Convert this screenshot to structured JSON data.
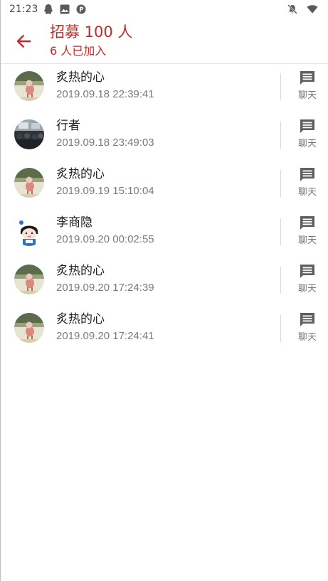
{
  "status_bar": {
    "time": "21:23",
    "icons_left": [
      "qq-icon",
      "image-icon",
      "p-icon"
    ],
    "icons_right": [
      "bell-off-icon",
      "wifi-icon"
    ]
  },
  "app_bar": {
    "title": "招募 100 人",
    "subtitle": "6 人已加入",
    "accent_color": "#c62828"
  },
  "members": [
    {
      "name": "炙热的心",
      "time": "2019.09.18 22:39:41",
      "avatar": "sheep-avatar",
      "chat_label": "聊天"
    },
    {
      "name": "行者",
      "time": "2019.09.18 23:49:03",
      "avatar": "crowd-photo-avatar",
      "chat_label": "聊天"
    },
    {
      "name": "炙热的心",
      "time": "2019.09.19 15:10:04",
      "avatar": "sheep-avatar",
      "chat_label": "聊天"
    },
    {
      "name": "李商隐",
      "time": "2019.09.20 00:02:55",
      "avatar": "cartoon-girl-avatar",
      "chat_label": "聊天"
    },
    {
      "name": "炙热的心",
      "time": "2019.09.20 17:24:39",
      "avatar": "sheep-avatar",
      "chat_label": "聊天"
    },
    {
      "name": "炙热的心",
      "time": "2019.09.20 17:24:41",
      "avatar": "sheep-avatar",
      "chat_label": "聊天"
    }
  ]
}
